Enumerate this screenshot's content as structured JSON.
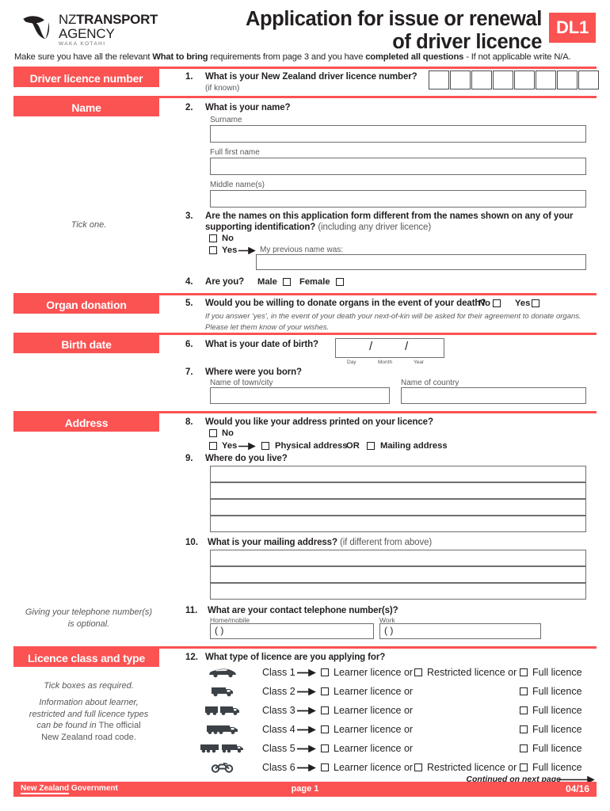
{
  "header": {
    "logo": {
      "nz": "NZ",
      "transport": "TRANSPORT",
      "agency": "AGENCY",
      "maori": "WAKA KOTAHI"
    },
    "title_line1": "Application for issue or renewal",
    "title_line2": "of driver licence",
    "form_code": "DL1",
    "instruction_a": "Make sure you have all the relevant ",
    "instruction_b": "What to bring",
    "instruction_c": " requirements from page 3 and you have ",
    "instruction_d": "completed all questions",
    "instruction_e": " - If not applicable write N/A."
  },
  "sections": {
    "licence_number": "Driver licence number",
    "name": "Name",
    "organ": "Organ donation",
    "birth": "Birth date",
    "address": "Address",
    "class": "Licence class and type"
  },
  "notes": {
    "tick_one": "Tick one.",
    "phone_optional_l1": "Giving your telephone number(s)",
    "phone_optional_l2": "is optional.",
    "tick_boxes": "Tick boxes as required.",
    "info_l1": "Information about learner,",
    "info_l2": "restricted and full licence types",
    "info_l3a": "can be found in ",
    "info_l3b": "The official",
    "info_l4": "New Zealand road code."
  },
  "q1": {
    "num": "1.",
    "text": "What is your New Zealand driver licence number?",
    "hint": "(if known)",
    "box_count": 8
  },
  "q2": {
    "num": "2.",
    "text": "What is your name?",
    "surname_label": "Surname",
    "first_label": "Full first name",
    "middle_label": "Middle name(s)"
  },
  "q3": {
    "num": "3.",
    "text_l1": "Are the names on this application form different from the names shown on any of your",
    "text_l2": "supporting identification?",
    "text_l2_sub": " (including any driver licence)",
    "no": "No",
    "yes": "Yes",
    "previous": "My previous name was:"
  },
  "q4": {
    "num": "4.",
    "text": "Are you?",
    "male": "Male",
    "female": "Female"
  },
  "q5": {
    "num": "5.",
    "text": "Would you be willing to donate organs in the event of your death?",
    "no": "No",
    "yes": "Yes",
    "note_l1": "If you answer 'yes', in the event of your death your next-of-kin will be asked for their agreement to donate organs.",
    "note_l2": "Please let them know of your wishes."
  },
  "q6": {
    "num": "6.",
    "text": "What is your date of birth?",
    "day": "Day",
    "month": "Month",
    "year": "Year",
    "sep": "/"
  },
  "q7": {
    "num": "7.",
    "text": "Where were you born?",
    "town_label": "Name of town/city",
    "country_label": "Name of country"
  },
  "q8": {
    "num": "8.",
    "text": "Would you like your address printed on your licence?",
    "no": "No",
    "yes": "Yes",
    "physical": "Physical address",
    "or": "OR",
    "mailing": "Mailing address"
  },
  "q9": {
    "num": "9.",
    "text": "Where do you live?",
    "rows": 4
  },
  "q10": {
    "num": "10.",
    "text": "What is your mailing address?",
    "sub": " (if different from above)",
    "rows": 3
  },
  "q11": {
    "num": "11.",
    "text": "What are your contact telephone number(s)?",
    "home_label": "Home/mobile",
    "work_label": "Work",
    "prefix": "(          )"
  },
  "q12": {
    "num": "12.",
    "text": "What type of licence are you applying for?",
    "learner": "Learner licence or",
    "restricted": "Restricted licence or",
    "full": "Full licence",
    "rows": [
      {
        "icon": "car-icon",
        "label": "Class 1",
        "has_restricted": true
      },
      {
        "icon": "truck-icon",
        "label": "Class 2",
        "has_restricted": false
      },
      {
        "icon": "double-truck-icon",
        "label": "Class 3",
        "has_restricted": false
      },
      {
        "icon": "long-truck-icon",
        "label": "Class 4",
        "has_restricted": false
      },
      {
        "icon": "truck-trailer-icon",
        "label": "Class 5",
        "has_restricted": false
      },
      {
        "icon": "motorcycle-icon",
        "label": "Class 6",
        "has_restricted": true
      }
    ],
    "continued": "Continued on next page"
  },
  "footer": {
    "govt_underlined": "New Zealand",
    "govt_rest": " Government",
    "page": "page 1",
    "version": "04/16"
  },
  "colors": {
    "accent": "#fb5252",
    "text": "#231f20",
    "muted": "#58595b",
    "field_border": "#6d6e71"
  }
}
